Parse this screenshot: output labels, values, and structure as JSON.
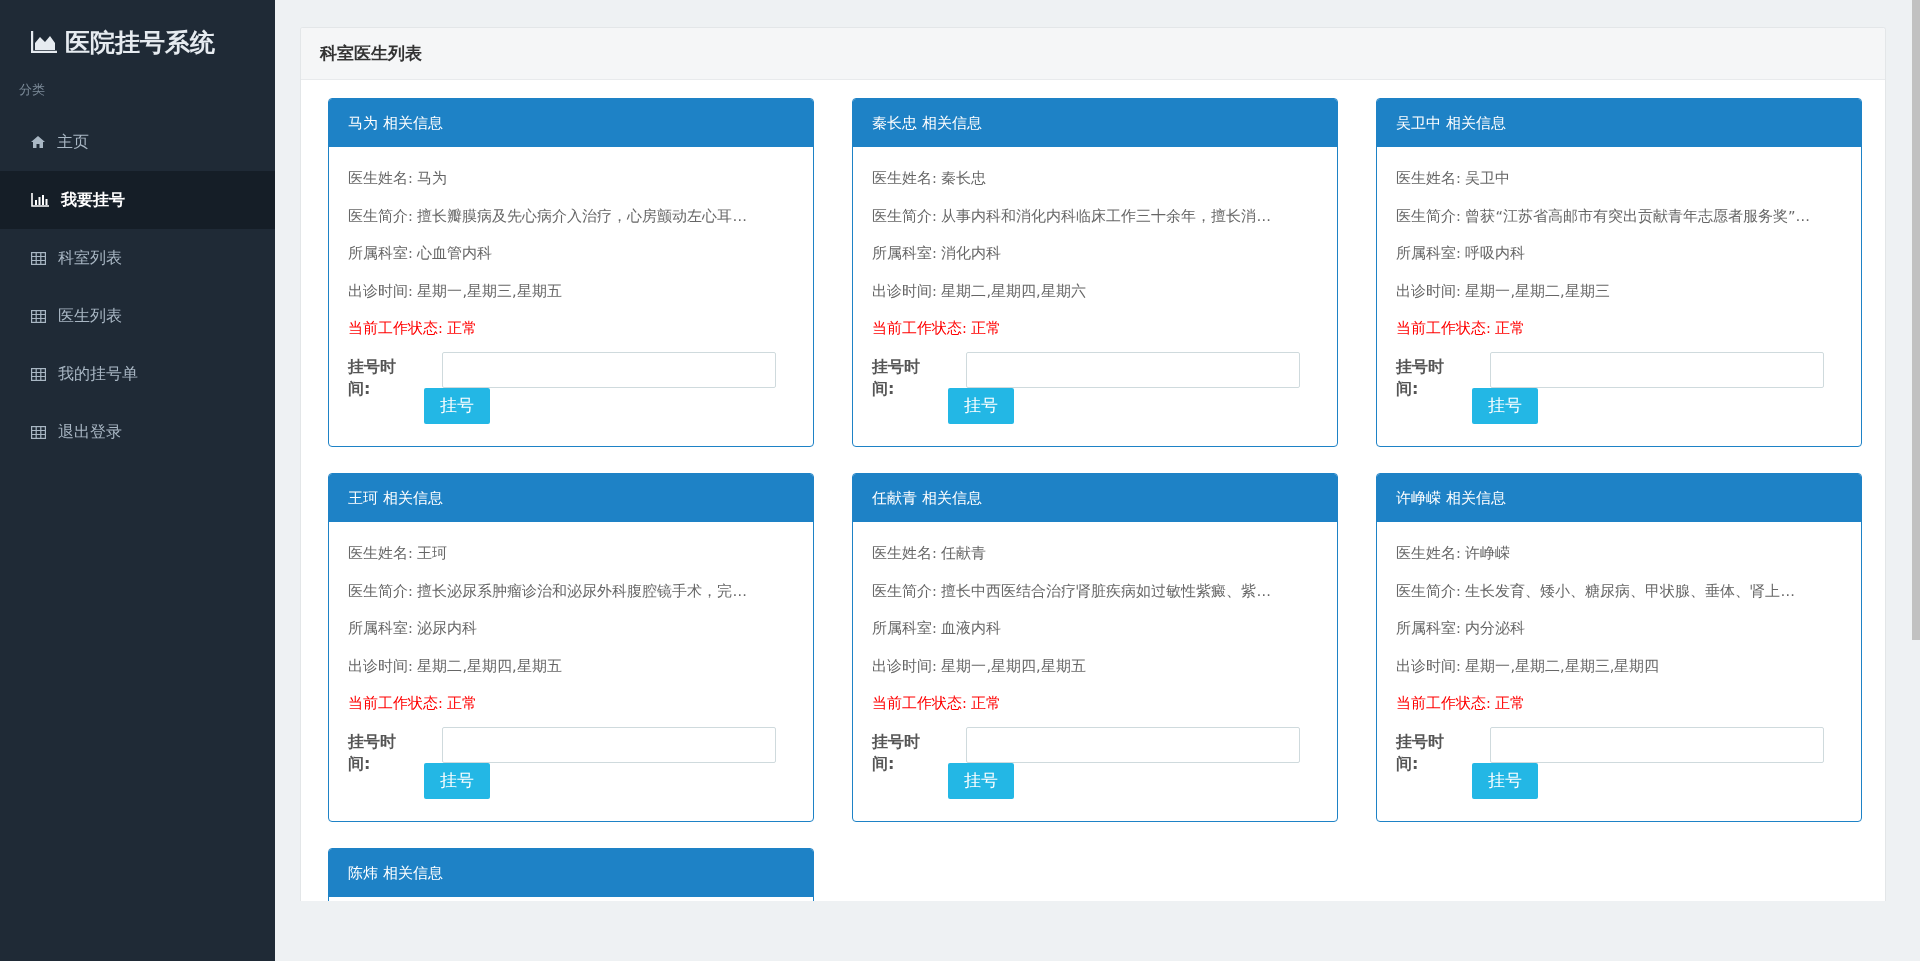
{
  "sidebar": {
    "brand": "医院挂号系统",
    "section_label": "分类",
    "items": [
      {
        "label": "主页",
        "kind": "home",
        "selected": false
      },
      {
        "label": "我要挂号",
        "kind": "chart",
        "selected": true
      },
      {
        "label": "科室列表",
        "kind": "table",
        "selected": false
      },
      {
        "label": "医生列表",
        "kind": "table",
        "selected": false
      },
      {
        "label": "我的挂号单",
        "kind": "table",
        "selected": false
      },
      {
        "label": "退出登录",
        "kind": "table",
        "selected": false
      }
    ]
  },
  "panel": {
    "title": "科室医生列表",
    "cards": [
      {
        "title": "马为 相关信息",
        "lines": [
          {
            "kind": "info",
            "text": "医生姓名: 马为"
          },
          {
            "kind": "info",
            "text": "医生简介: 擅长瓣膜病及先心病介入治疗，心房颤动左心耳…"
          },
          {
            "kind": "info",
            "text": "所属科室: 心血管内科"
          },
          {
            "kind": "info",
            "text": "出诊时间: 星期一,星期三,星期五"
          },
          {
            "kind": "status",
            "text": "当前工作状态: 正常"
          }
        ],
        "form": {
          "label": "挂号时间:",
          "button": "挂号"
        }
      },
      {
        "title": "秦长忠 相关信息",
        "lines": [
          {
            "kind": "info",
            "text": "医生姓名: 秦长忠"
          },
          {
            "kind": "info",
            "text": "医生简介: 从事内科和消化内科临床工作三十余年，擅长消…"
          },
          {
            "kind": "info",
            "text": "所属科室: 消化内科"
          },
          {
            "kind": "info",
            "text": "出诊时间: 星期二,星期四,星期六"
          },
          {
            "kind": "status",
            "text": "当前工作状态: 正常"
          }
        ],
        "form": {
          "label": "挂号时间:",
          "button": "挂号"
        }
      },
      {
        "title": "吴卫中 相关信息",
        "lines": [
          {
            "kind": "info",
            "text": "医生姓名: 吴卫中"
          },
          {
            "kind": "info",
            "text": "医生简介: 曾获“江苏省高邮市有突出贡献青年志愿者服务奖”…"
          },
          {
            "kind": "info",
            "text": "所属科室: 呼吸内科"
          },
          {
            "kind": "info",
            "text": "出诊时间: 星期一,星期二,星期三"
          },
          {
            "kind": "status",
            "text": "当前工作状态: 正常"
          }
        ],
        "form": {
          "label": "挂号时间:",
          "button": "挂号"
        }
      },
      {
        "title": "王珂 相关信息",
        "lines": [
          {
            "kind": "info",
            "text": "医生姓名: 王珂"
          },
          {
            "kind": "info",
            "text": "医生简介: 擅长泌尿系肿瘤诊治和泌尿外科腹腔镜手术，完…"
          },
          {
            "kind": "info",
            "text": "所属科室: 泌尿内科"
          },
          {
            "kind": "info",
            "text": "出诊时间: 星期二,星期四,星期五"
          },
          {
            "kind": "status",
            "text": "当前工作状态: 正常"
          }
        ],
        "form": {
          "label": "挂号时间:",
          "button": "挂号"
        }
      },
      {
        "title": "任献青 相关信息",
        "lines": [
          {
            "kind": "info",
            "text": "医生姓名: 任献青"
          },
          {
            "kind": "info",
            "text": "医生简介: 擅长中西医结合治疗肾脏疾病如过敏性紫癜、紫…"
          },
          {
            "kind": "info",
            "text": "所属科室: 血液内科"
          },
          {
            "kind": "info",
            "text": "出诊时间: 星期一,星期四,星期五"
          },
          {
            "kind": "status",
            "text": "当前工作状态: 正常"
          }
        ],
        "form": {
          "label": "挂号时间:",
          "button": "挂号"
        }
      },
      {
        "title": "许峥嵘 相关信息",
        "lines": [
          {
            "kind": "info",
            "text": "医生姓名: 许峥嵘"
          },
          {
            "kind": "info",
            "text": "医生简介: 生长发育、矮小、糖尿病、甲状腺、垂体、肾上…"
          },
          {
            "kind": "info",
            "text": "所属科室: 内分泌科"
          },
          {
            "kind": "info",
            "text": "出诊时间: 星期一,星期二,星期三,星期四"
          },
          {
            "kind": "status",
            "text": "当前工作状态: 正常"
          }
        ],
        "form": {
          "label": "挂号时间:",
          "button": "挂号"
        }
      },
      {
        "title": "陈炜 相关信息"
      }
    ]
  }
}
